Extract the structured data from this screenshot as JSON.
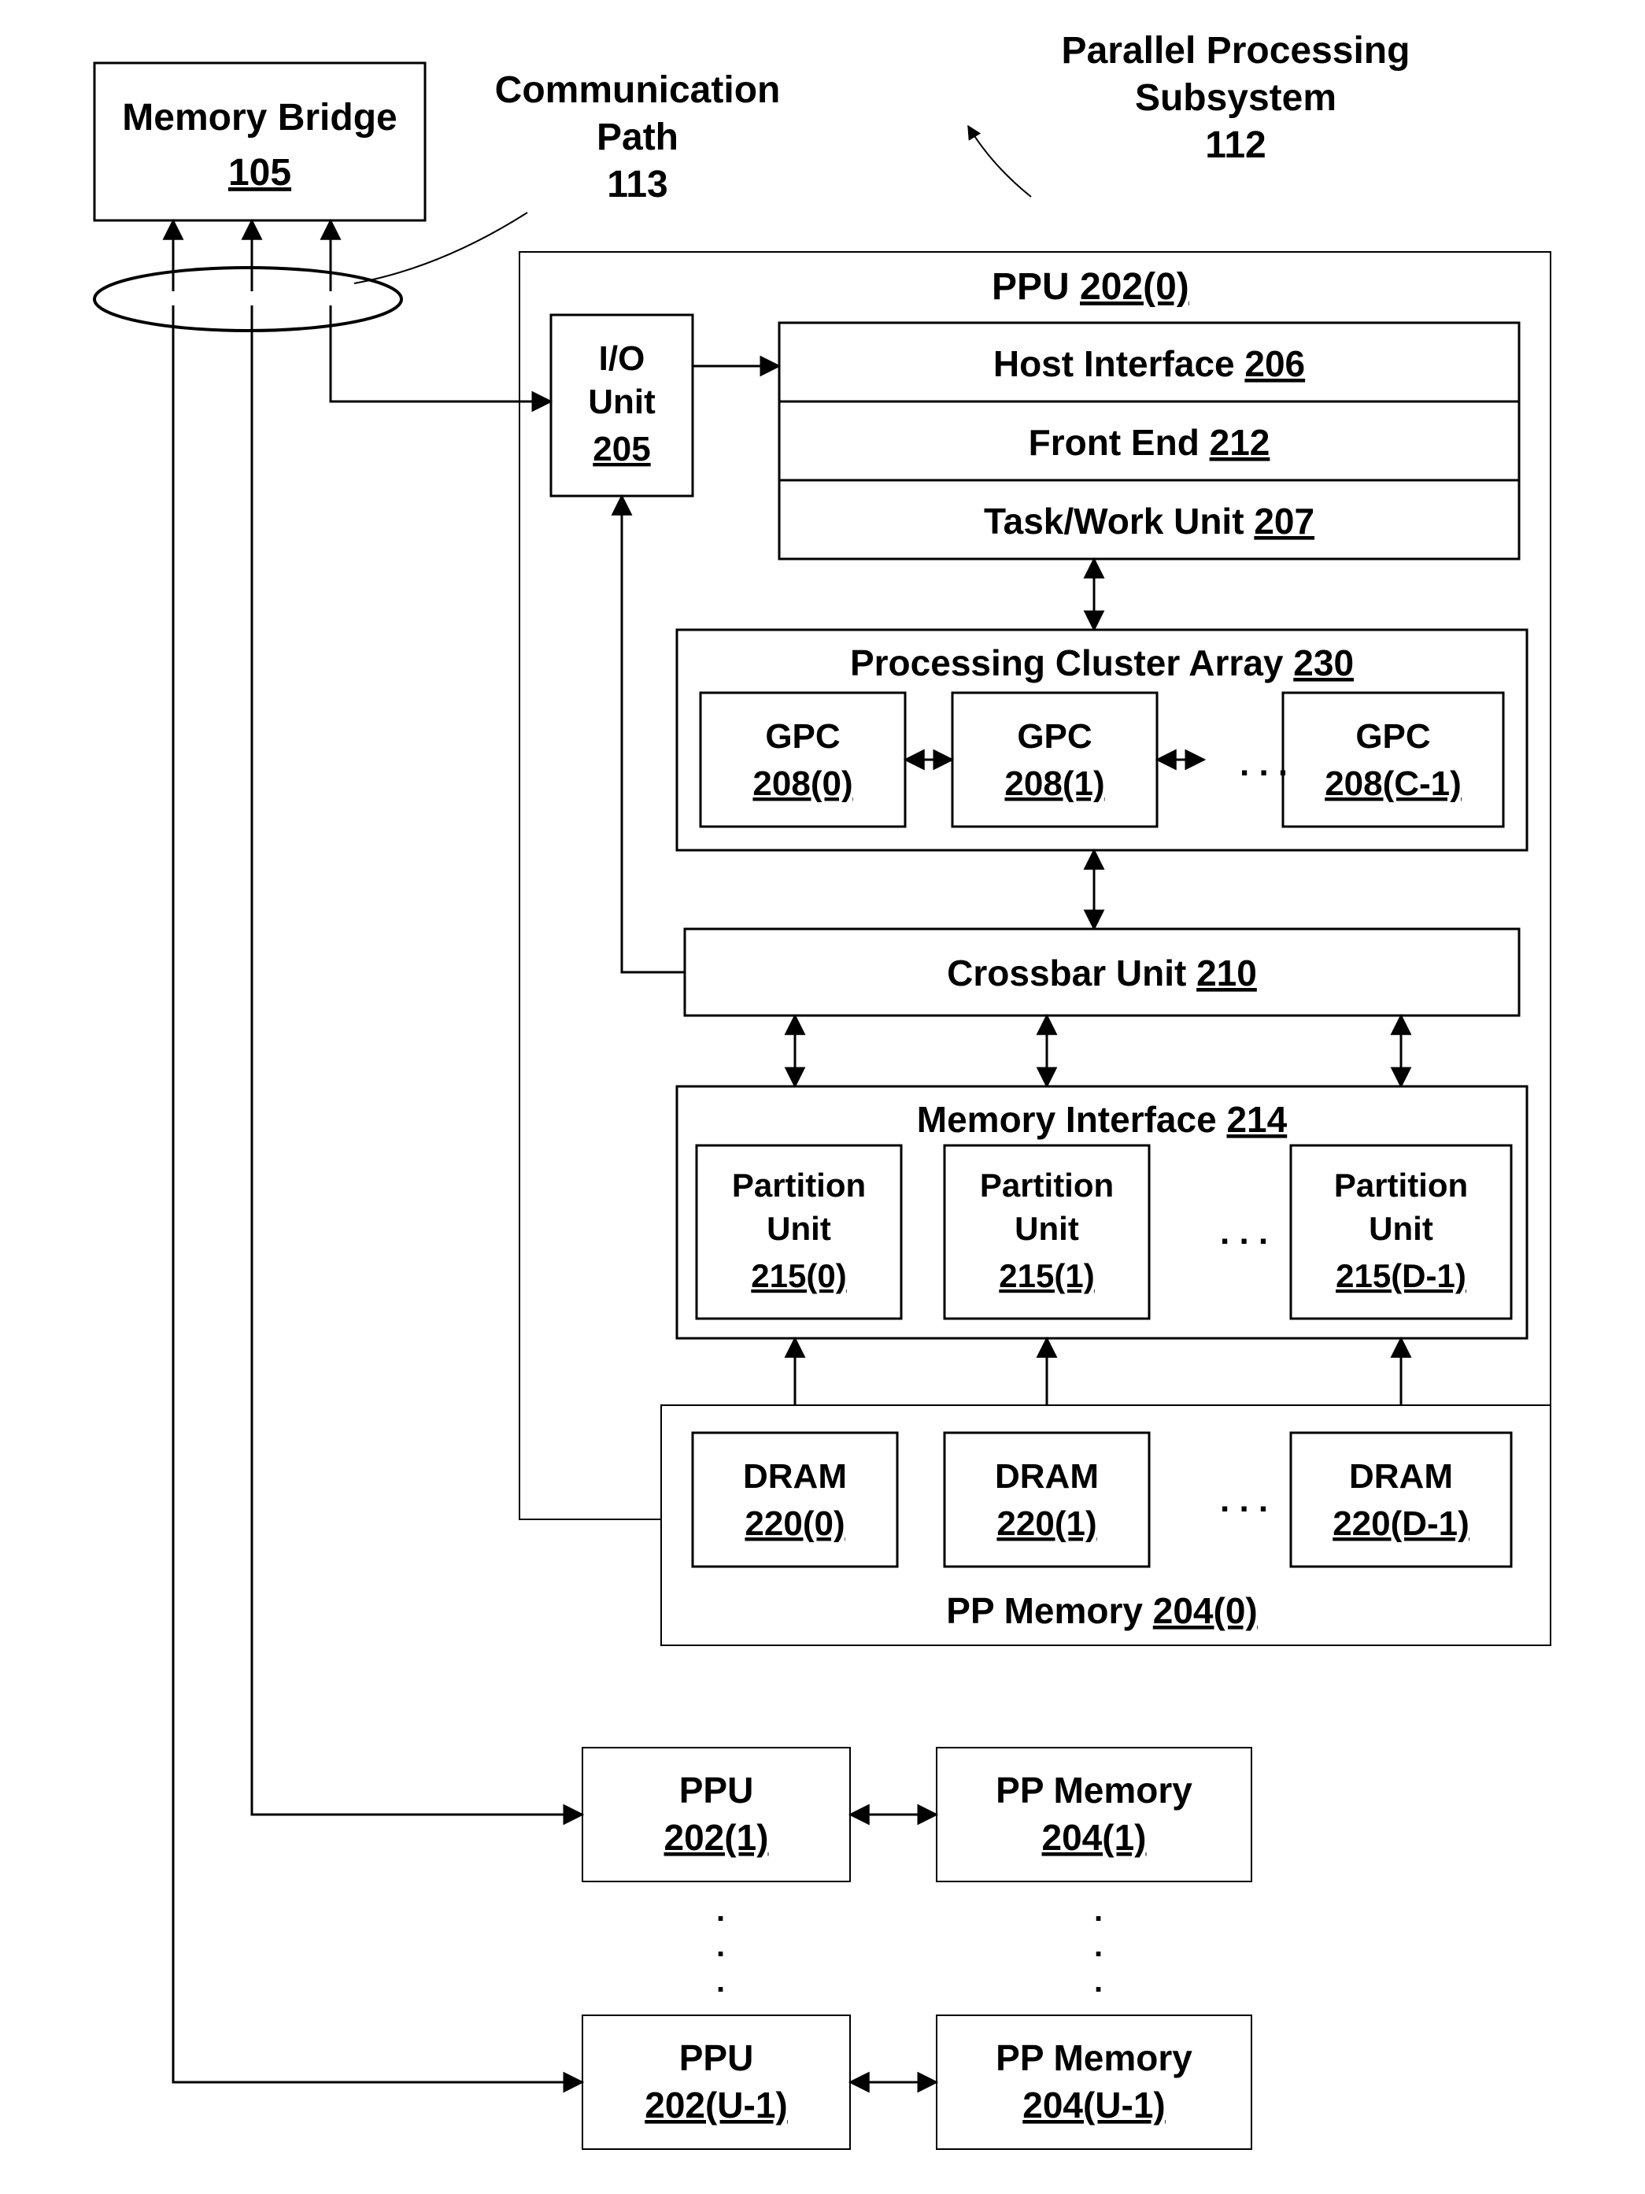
{
  "memory_bridge": {
    "title": "Memory Bridge",
    "num": "105"
  },
  "comm_path": {
    "title": "Communication",
    "sub": "Path",
    "num": "113"
  },
  "pps": {
    "title": "Parallel Processing",
    "sub": "Subsystem",
    "num": "112"
  },
  "ppu0": {
    "title": "PPU ",
    "num": "202(0)"
  },
  "io": {
    "title": "I/O",
    "sub": "Unit",
    "num": "205"
  },
  "host": {
    "title": "Host Interface ",
    "num": "206"
  },
  "front": {
    "title": "Front End ",
    "num": "212"
  },
  "task": {
    "title": "Task/Work Unit ",
    "num": "207"
  },
  "pca": {
    "title": "Processing Cluster Array ",
    "num": "230"
  },
  "gpc": [
    {
      "title": "GPC",
      "num": "208(0)"
    },
    {
      "title": "GPC",
      "num": "208(1)"
    },
    {
      "title": "GPC",
      "num": "208(C-1)"
    }
  ],
  "crossbar": {
    "title": "Crossbar Unit ",
    "num": "210"
  },
  "mif": {
    "title": "Memory Interface ",
    "num": "214"
  },
  "pu": [
    {
      "title": "Partition",
      "sub": "Unit",
      "num": "215(0)"
    },
    {
      "title": "Partition",
      "sub": "Unit",
      "num": "215(1)"
    },
    {
      "title": "Partition",
      "sub": "Unit",
      "num": "215(D-1)"
    }
  ],
  "ppmem0": {
    "title": "PP Memory ",
    "num": "204(0)"
  },
  "dram": [
    {
      "title": "DRAM",
      "num": "220(0)"
    },
    {
      "title": "DRAM",
      "num": "220(1)"
    },
    {
      "title": "DRAM",
      "num": "220(D-1)"
    }
  ],
  "ppu1": {
    "title": "PPU",
    "num": "202(1)"
  },
  "ppmem1": {
    "title": "PP Memory",
    "num": "204(1)"
  },
  "ppuU": {
    "title": "PPU",
    "num": "202(U-1)"
  },
  "ppmemU": {
    "title": "PP Memory",
    "num": "204(U-1)"
  }
}
